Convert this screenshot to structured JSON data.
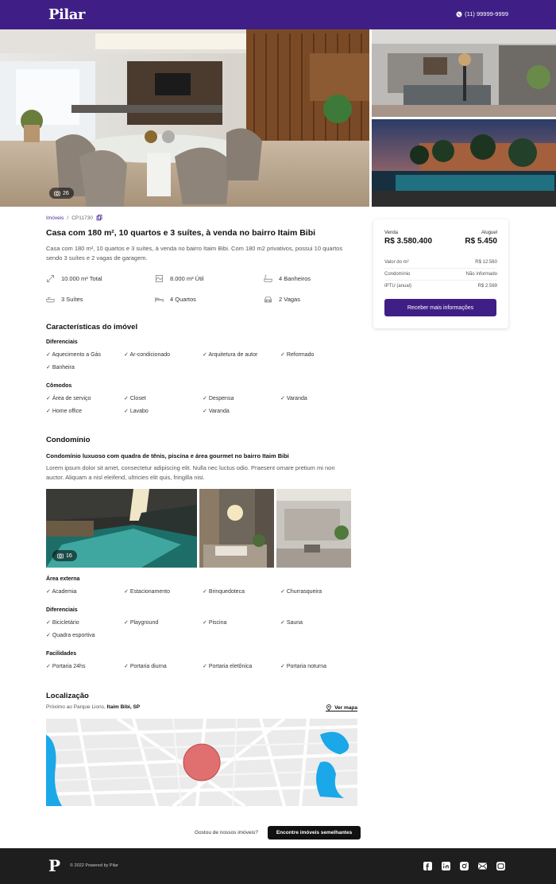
{
  "header": {
    "logo": "Pilar",
    "phone": "(11) 99999-9999"
  },
  "gallery": {
    "photo_count": "26"
  },
  "breadcrumb": {
    "section": "Imóveis",
    "separator": "/",
    "code": "CP11730"
  },
  "property": {
    "title": "Casa com 180 m², 10 quartos e 3 suítes, à venda no bairro Itaim Bibi",
    "description": "Casa com 180 m², 10 quartos e 3 suítes, à venda no bairro Itaim Bibi. Com 180 m2 privativos, possui 10 quartos sendo 3 suítes e 2 vagas de garagem.",
    "features": [
      {
        "icon": "area-total-icon",
        "label": "10.000 m² Total"
      },
      {
        "icon": "area-useful-icon",
        "label": "8.000 m² Útil"
      },
      {
        "icon": "bathtub-icon",
        "label": "4 Banheiros"
      },
      {
        "icon": "bath-suite-icon",
        "label": "3 Suítes"
      },
      {
        "icon": "bed-icon",
        "label": "4 Quartos"
      },
      {
        "icon": "car-icon",
        "label": "2 Vagas"
      }
    ]
  },
  "characteristics": {
    "title": "Características do imóvel",
    "diferenciais": {
      "label": "Diferenciais",
      "items": [
        "Aquecimento a Gás",
        "Ar-condicionado",
        "Arquitetura de autor",
        "Reformado",
        "Banheira"
      ]
    },
    "comodos": {
      "label": "Cômodos",
      "items": [
        "Área de serviço",
        "Closet",
        "Despensa",
        "Varanda",
        "Home office",
        "Lavabo",
        "Varanda"
      ]
    }
  },
  "condominio": {
    "title": "Condomínio",
    "subtitle": "Condomínio luxuoso com quadra de tênis, piscina e área gourmet no bairro Itaim Bibi",
    "text": "Lorem ipsum dolor sit amet, consectetur adipiscing elit. Nulla nec luctus odio. Praesent ornare pretium mi non auctor. Aliquam a nisl eleifend, ultricies elit quis, fringilla nisi.",
    "photo_count": "16",
    "area_externa": {
      "label": "Área externa",
      "items": [
        "Academia",
        "Estacionamento",
        "Brinquedoteca",
        "Churrasqueira"
      ]
    },
    "diferenciais": {
      "label": "Diferenciais",
      "items": [
        "Bicicletário",
        "Playground",
        "Piscina",
        "Sauna",
        "Quadra esportiva"
      ]
    },
    "facilidades": {
      "label": "Facilidades",
      "items": [
        "Portaria 24hs",
        "Portaria diurna",
        "Portaria eletônica",
        "Portaria noturna"
      ]
    }
  },
  "location": {
    "title": "Localização",
    "near": "Próximo ao Parque Lions,",
    "place": "Itaim Bibi, SP",
    "map_link": "Ver mapa"
  },
  "price_card": {
    "sale_label": "Venda",
    "sale_value": "R$ 3.580.400",
    "rent_label": "Aluguel",
    "rent_value": "R$ 5.450",
    "rows": [
      {
        "label": "Valor do m²",
        "value": "R$ 12.560"
      },
      {
        "label": "Condomínio",
        "value": "Não informado"
      },
      {
        "label": "IPTU (anual)",
        "value": "R$ 2.569"
      }
    ],
    "button": "Receber mais informações"
  },
  "cta": {
    "text": "Gostou de nossos imóveis?",
    "button": "Encontre imóveis semelhantes"
  },
  "footer": {
    "logo": "P",
    "copyright": "© 2022 Powered by Pilar",
    "socials": [
      "facebook-icon",
      "linkedin-icon",
      "instagram-icon",
      "email-icon",
      "youtube-icon"
    ]
  },
  "colors": {
    "brand": "#3f1f86",
    "footer": "#1e1e1e",
    "water": "#1aa8e8",
    "location_circle": "#e07070"
  }
}
